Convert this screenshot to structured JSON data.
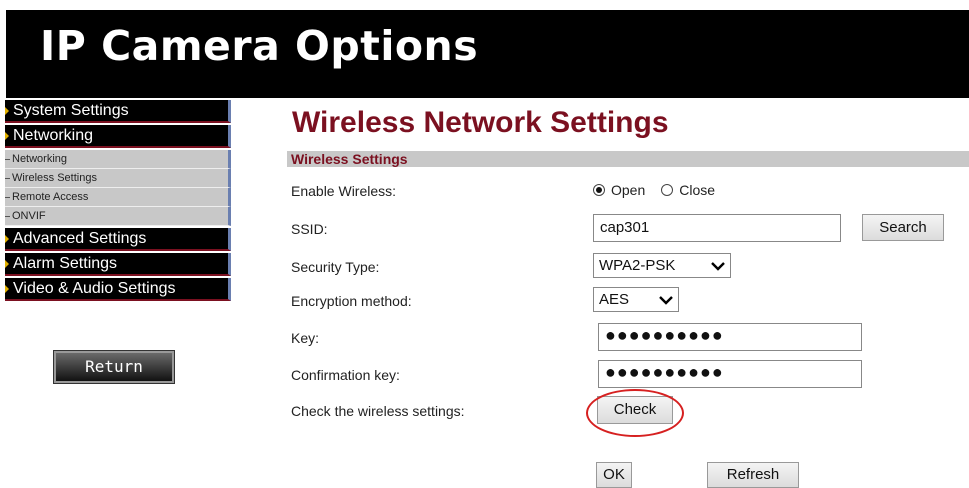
{
  "header": {
    "title": "IP Camera Options"
  },
  "nav": {
    "system_settings": "System Settings",
    "networking": "Networking",
    "sub": [
      "Networking",
      "Wireless Settings",
      "Remote Access",
      "ONVIF"
    ],
    "advanced_settings": "Advanced Settings",
    "alarm_settings": "Alarm Settings",
    "video_audio_settings": "Video & Audio Settings",
    "return_label": "Return"
  },
  "main": {
    "title": "Wireless Network Settings",
    "section": "Wireless Settings",
    "labels": {
      "enable_wireless": "Enable Wireless:",
      "ssid": "SSID:",
      "security_type": "Security Type:",
      "encryption": "Encryption method:",
      "key": "Key:",
      "confirm_key": "Confirmation key:",
      "check_settings": "Check the wireless settings:"
    },
    "enable_wireless": {
      "open_label": "Open",
      "close_label": "Close",
      "selected": "Open"
    },
    "ssid_value": "cap301",
    "search_label": "Search",
    "security_type_value": "WPA2-PSK",
    "encryption_value": "AES",
    "key_value": "●●●●●●●●●●",
    "confirm_key_value": "●●●●●●●●●●",
    "check_label": "Check",
    "ok_label": "OK",
    "refresh_label": "Refresh"
  },
  "colors": {
    "accent": "#7b1020",
    "highlight": "#d62020",
    "nav_bg": "#000000",
    "section_bg": "#c8c8c8"
  }
}
